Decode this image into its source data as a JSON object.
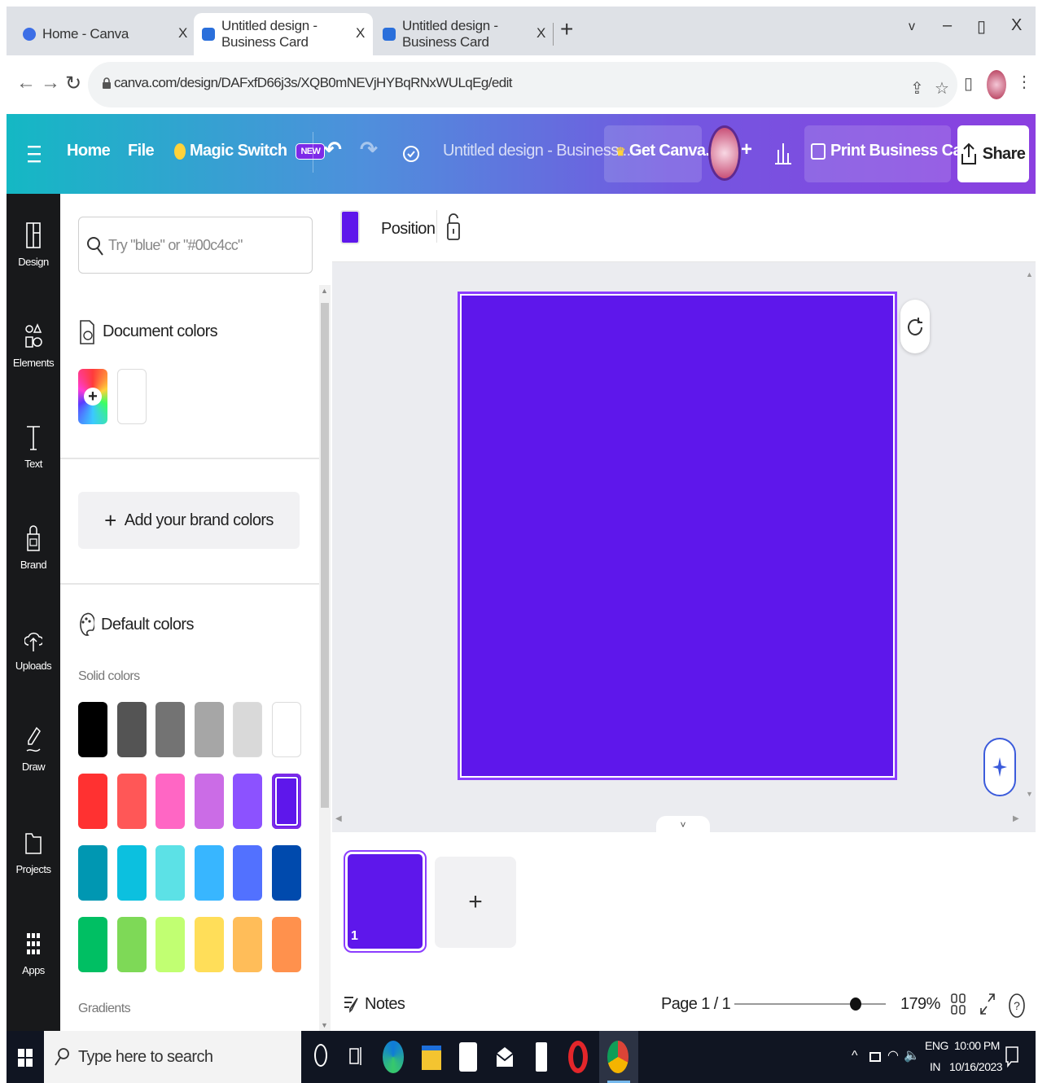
{
  "browser": {
    "tabs": [
      {
        "title": "Home - Canva",
        "close": "X"
      },
      {
        "title": "Untitled design - Business Card",
        "close": "X"
      },
      {
        "title": "Untitled design - Business Card",
        "close": "X"
      }
    ],
    "new_tab": "+",
    "window_controls": {
      "menu": "v",
      "minimize": "–",
      "restore": "▯",
      "close": "X"
    },
    "url": "canva.com/design/DAFxfD66j3s/XQB0mNEVjHYBqRNxWULqEg/edit"
  },
  "header": {
    "home": "Home",
    "file": "File",
    "magic_switch": "Magic Switch",
    "new_badge": "NEW",
    "doc_title": "Untitled design - Business...",
    "get_canva": "Get Canva...",
    "add_people": "+",
    "print": "Print Business Cards",
    "share": "Share",
    "colors": {
      "accent": "#7d2ae8",
      "gradient_start": "#14b8c4",
      "gradient_end": "#8b3fe0"
    }
  },
  "rail": [
    {
      "label": "Design",
      "icon": "layout-icon"
    },
    {
      "label": "Elements",
      "icon": "shapes-icon"
    },
    {
      "label": "Text",
      "icon": "text-icon"
    },
    {
      "label": "Brand",
      "icon": "brand-icon"
    },
    {
      "label": "Uploads",
      "icon": "cloud-upload-icon"
    },
    {
      "label": "Draw",
      "icon": "pen-icon"
    },
    {
      "label": "Projects",
      "icon": "folder-icon"
    },
    {
      "label": "Apps",
      "icon": "grid-icon"
    }
  ],
  "panel": {
    "search_placeholder": "Try \"blue\" or \"#00c4cc\"",
    "document_colors_title": "Document colors",
    "document_colors": [
      "#ffffff"
    ],
    "add_brand": "Add your brand colors",
    "default_colors_title": "Default colors",
    "solid_label": "Solid colors",
    "gradients_label": "Gradients",
    "solid_colors": [
      [
        "#000000",
        "#545454",
        "#737373",
        "#a6a6a6",
        "#d9d9d9",
        "#ffffff"
      ],
      [
        "#ff3131",
        "#ff5757",
        "#ff66c4",
        "#cb6ce6",
        "#8c52ff",
        "#5e17eb"
      ],
      [
        "#0097b2",
        "#0cc0df",
        "#5ce1e6",
        "#38b6ff",
        "#5271ff",
        "#004aad"
      ],
      [
        "#00bf63",
        "#7ed957",
        "#c1ff72",
        "#ffde59",
        "#ffbd59",
        "#ff914d"
      ]
    ],
    "selected_color": "#5e17eb"
  },
  "toolbar": {
    "color": "#5e17eb",
    "position": "Position"
  },
  "canvas": {
    "page_color": "#5e17eb",
    "collapse": "˅"
  },
  "pages_strip": {
    "page_number": "1",
    "add": "+"
  },
  "footer": {
    "notes": "Notes",
    "page": "Page 1 / 1",
    "zoom": "179%",
    "zoom_level_fraction": 0.8
  },
  "taskbar": {
    "search": "Type here to search",
    "lang1": "ENG",
    "lang2": "IN",
    "time": "10:00 PM",
    "date": "10/16/2023",
    "tray_up": "^"
  }
}
